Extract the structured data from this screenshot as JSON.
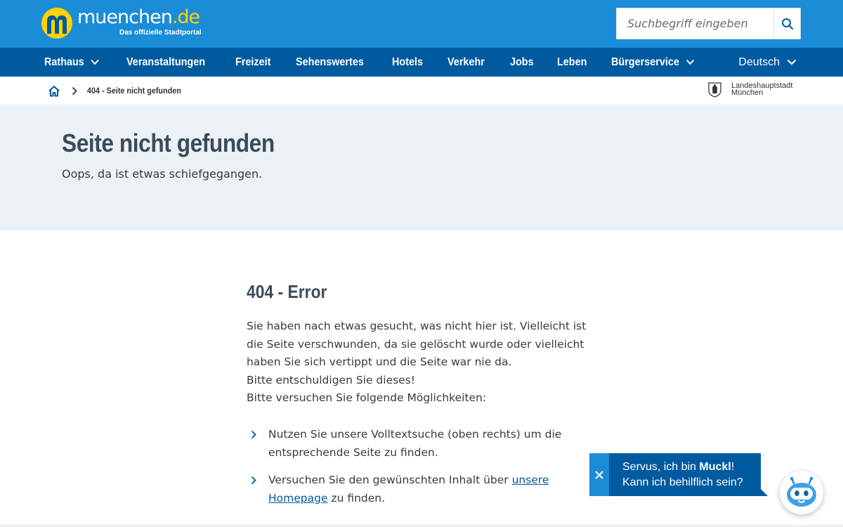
{
  "header": {
    "logo_name": "muenchen",
    "logo_tld": ".de",
    "logo_tagline": "Das offizielle Stadtportal",
    "search_placeholder": "Suchbegriff eingeben",
    "search_icon": "search-icon"
  },
  "nav": {
    "items": [
      {
        "label": "Rathaus",
        "dropdown": true
      },
      {
        "label": "Veranstaltungen",
        "dropdown": false
      },
      {
        "label": "Freizeit",
        "dropdown": false
      },
      {
        "label": "Sehenswertes",
        "dropdown": false
      },
      {
        "label": "Hotels",
        "dropdown": false
      },
      {
        "label": "Verkehr",
        "dropdown": false
      },
      {
        "label": "Jobs",
        "dropdown": false
      },
      {
        "label": "Leben",
        "dropdown": false
      },
      {
        "label": "Bürgerservice",
        "dropdown": true
      }
    ],
    "language": "Deutsch"
  },
  "breadcrumb": {
    "home_icon": "home-icon",
    "current": "404 - Seite nicht gefunden",
    "city_label_line1": "Landeshauptstadt",
    "city_label_line2": "München"
  },
  "hero": {
    "title": "Seite nicht gefunden",
    "subtitle": "Oops, da ist etwas schiefgegangen."
  },
  "content": {
    "heading": "404 - Error",
    "lines": [
      "Sie haben nach etwas gesucht, was nicht hier ist. Vielleicht ist",
      "die Seite verschwunden, da sie gelöscht wurde oder vielleicht",
      "haben Sie sich vertippt und die Seite war nie da.",
      "Bitte entschuldigen Sie dieses!",
      "Bitte versuchen Sie folgende Möglichkeiten:"
    ],
    "tip1": "Nutzen Sie unsere Volltextsuche (oben rechts) um die entsprechende Seite zu finden.",
    "tip2_before": "Versuchen Sie den gewünschten Inhalt über ",
    "tip2_link": "unsere Homepage",
    "tip2_after": " zu finden."
  },
  "chat": {
    "greeting_prefix": "Servus, ich bin ",
    "bot_name": "Muckl",
    "greeting_suffix": "!",
    "question": "Kann ich behilflich sein?",
    "close_icon": "close-icon",
    "avatar_icon": "chatbot-icon"
  },
  "colors": {
    "topbar": "#1a8cd8",
    "navbar": "#005a9f",
    "hero_bg": "#ecf1f5",
    "logo_yellow": "#ffd400",
    "heading": "#3b4b5a"
  }
}
